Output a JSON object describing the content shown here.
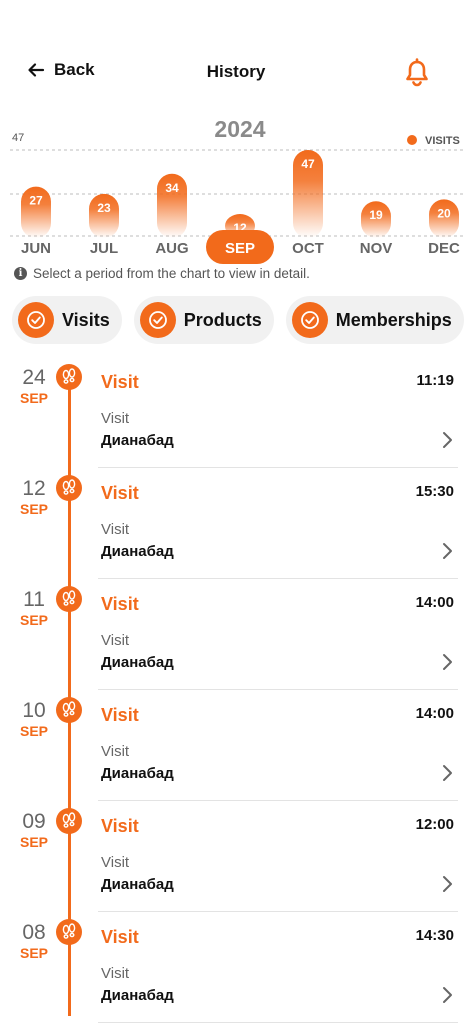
{
  "header": {
    "back_label": "Back",
    "title": "History",
    "back_icon": "arrow-left-icon",
    "bell_icon": "bell-icon"
  },
  "colors": {
    "accent": "#f26a1b",
    "accent_light": "#ffffff",
    "chip_bg": "#f1f1f1",
    "muted": "#8a8a8a"
  },
  "chart_data": {
    "type": "bar",
    "title": "2024",
    "max_label": "47",
    "legend": "VISITS",
    "categories": [
      "JUN",
      "JUL",
      "AUG",
      "SEP",
      "OCT",
      "NOV",
      "DEC"
    ],
    "series": [
      {
        "name": "VISITS",
        "values": [
          27,
          23,
          34,
          12,
          47,
          19,
          20
        ]
      }
    ],
    "selected": "SEP",
    "ylim": [
      0,
      47
    ],
    "grid": true,
    "legend_position": "top-right"
  },
  "hint": "Select a period from the chart to view in detail.",
  "filters": [
    {
      "label": "Visits",
      "checked": true
    },
    {
      "label": "Products",
      "checked": true
    },
    {
      "label": "Memberships",
      "checked": true
    }
  ],
  "entries": [
    {
      "day": "24",
      "month": "SEP",
      "title": "Visit",
      "time": "11:19",
      "type": "Visit",
      "place": "Дианабад"
    },
    {
      "day": "12",
      "month": "SEP",
      "title": "Visit",
      "time": "15:30",
      "type": "Visit",
      "place": "Дианабад"
    },
    {
      "day": "11",
      "month": "SEP",
      "title": "Visit",
      "time": "14:00",
      "type": "Visit",
      "place": "Дианабад"
    },
    {
      "day": "10",
      "month": "SEP",
      "title": "Visit",
      "time": "14:00",
      "type": "Visit",
      "place": "Дианабад"
    },
    {
      "day": "09",
      "month": "SEP",
      "title": "Visit",
      "time": "12:00",
      "type": "Visit",
      "place": "Дианабад"
    },
    {
      "day": "08",
      "month": "SEP",
      "title": "Visit",
      "time": "14:30",
      "type": "Visit",
      "place": "Дианабад"
    }
  ]
}
